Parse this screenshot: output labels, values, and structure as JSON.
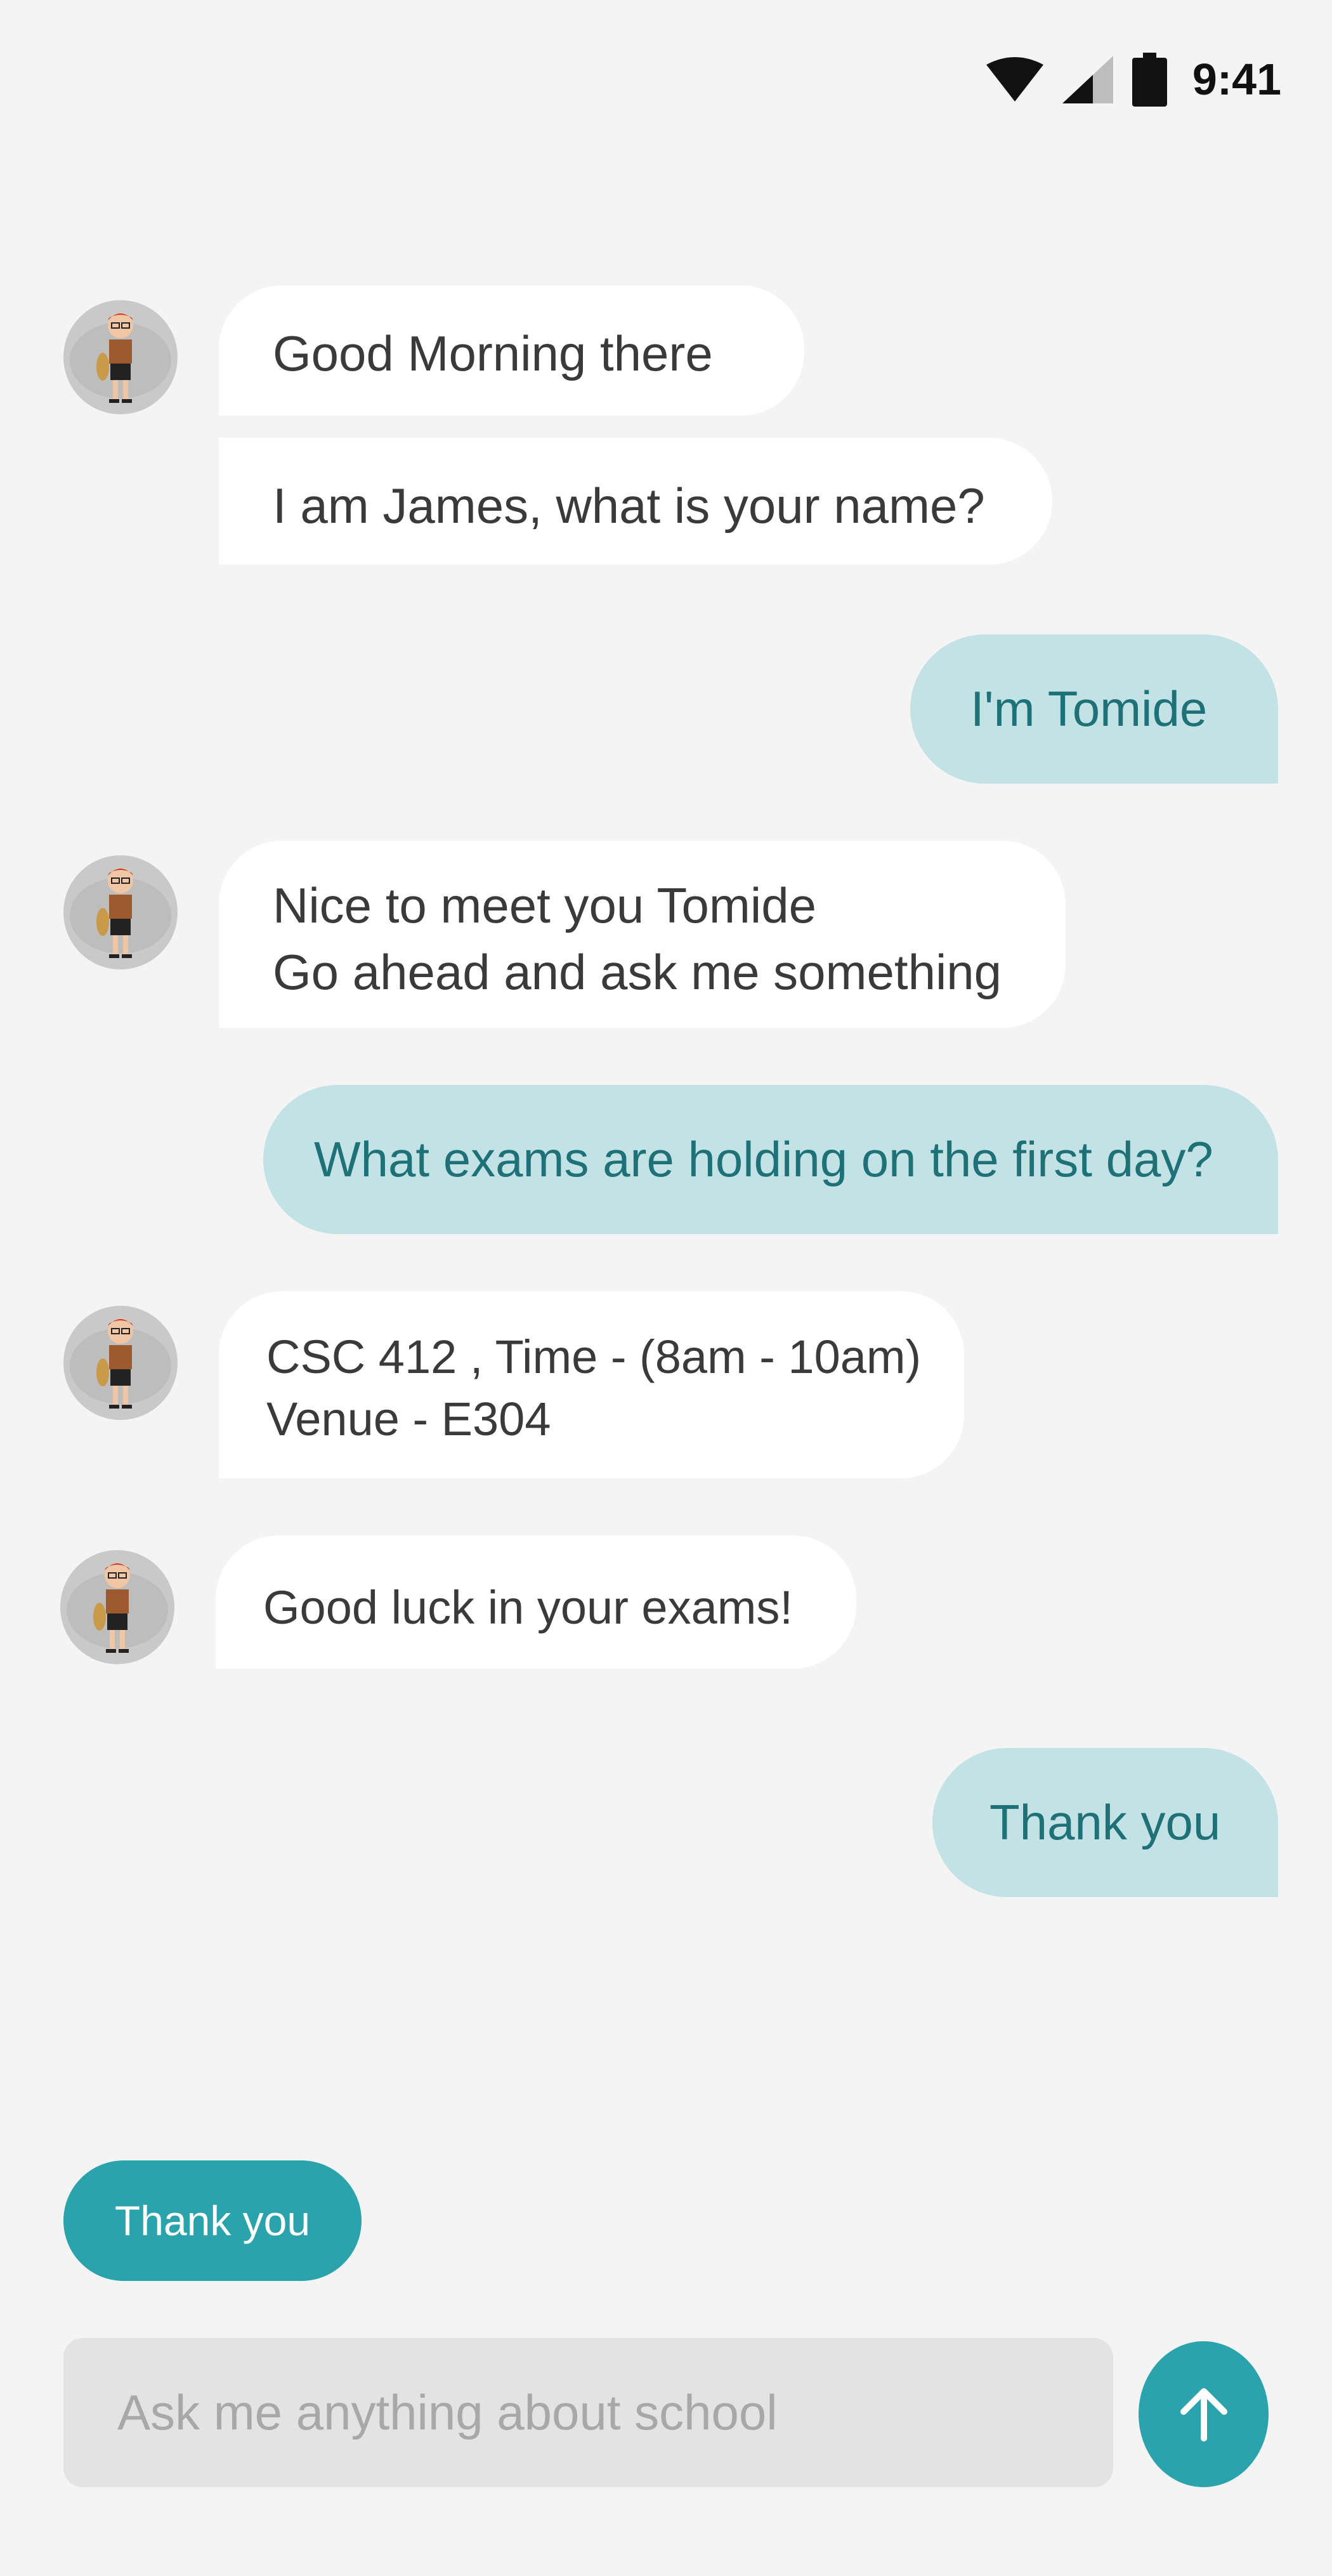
{
  "status_bar": {
    "time": "9:41",
    "icons": [
      "wifi-icon",
      "signal-icon",
      "battery-icon"
    ]
  },
  "messages": [
    {
      "sender": "bot",
      "lines": [
        "Good Morning there"
      ]
    },
    {
      "sender": "bot",
      "lines": [
        "I am James, what is your name?"
      ]
    },
    {
      "sender": "user",
      "lines": [
        "I'm Tomide"
      ]
    },
    {
      "sender": "bot",
      "lines": [
        "Nice to meet you Tomide",
        "Go ahead and ask me something"
      ]
    },
    {
      "sender": "user",
      "lines": [
        "What exams are holding on the first day?"
      ]
    },
    {
      "sender": "bot",
      "lines": [
        "CSC 412 , Time - (8am - 10am)",
        "Venue - E304"
      ]
    },
    {
      "sender": "bot",
      "lines": [
        "Good luck in your exams!"
      ]
    },
    {
      "sender": "user",
      "lines": [
        "Thank you"
      ]
    }
  ],
  "quick_reply": {
    "label": "Thank you"
  },
  "composer": {
    "placeholder": "Ask me anything about school"
  },
  "colors": {
    "accent": "#2aa3ad",
    "user_bubble": "#c3e2e5",
    "user_text": "#1e7177",
    "bot_bubble": "#ffffff",
    "background": "#f4f4f4"
  }
}
